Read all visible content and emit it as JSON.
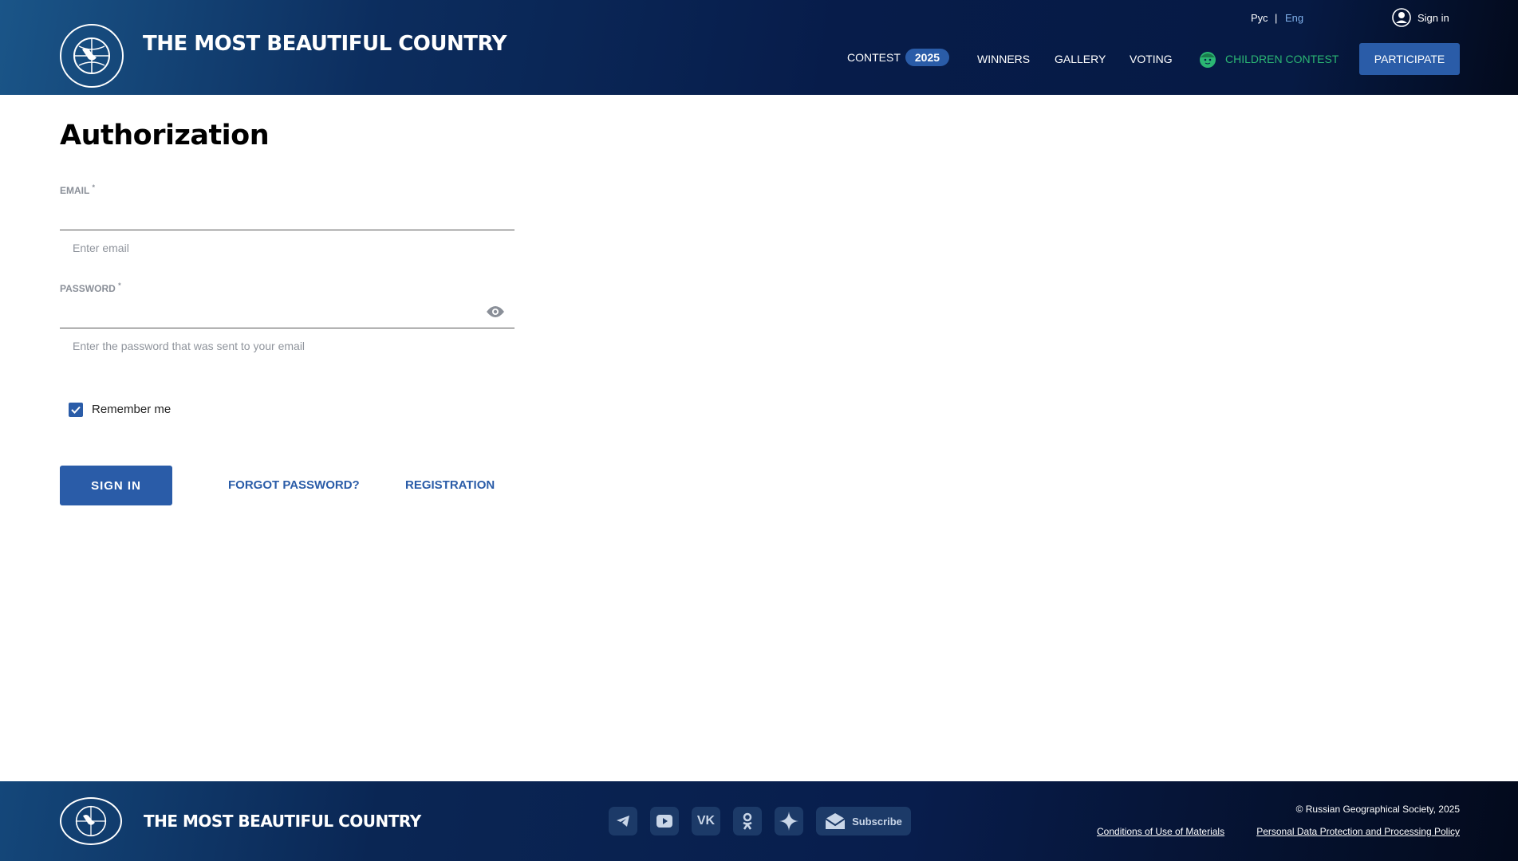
{
  "header": {
    "title": "THE MOST BEAUTIFUL COUNTRY",
    "lang_ru": "Рус",
    "lang_sep": "|",
    "lang_en": "Eng",
    "sign_in": "Sign in",
    "nav": {
      "contest": "CONTEST",
      "contest_year": "2025",
      "winners": "WINNERS",
      "gallery": "GALLERY",
      "voting": "VOTING",
      "children": "CHILDREN CONTEST",
      "participate": "PARTICIPATE"
    }
  },
  "form": {
    "title": "Authorization",
    "email_label": "EMAIL",
    "required": "*",
    "email_hint": "Enter email",
    "password_label": "PASSWORD",
    "password_hint": "Enter the password that was sent to your email",
    "remember": "Remember me",
    "remember_checked": true,
    "sign_in": "SIGN IN",
    "forgot": "FORGOT PASSWORD?",
    "registration": "REGISTRATION"
  },
  "footer": {
    "title": "THE MOST BEAUTIFUL COUNTRY",
    "subscribe": "Subscribe",
    "copyright": "© Russian Geographical Society, 2025",
    "conditions": "Conditions of Use of Materials",
    "privacy": "Personal Data Protection and Processing Policy",
    "social": [
      "telegram-icon",
      "youtube-icon",
      "vk-icon",
      "odnoklassniki-icon",
      "dzen-icon"
    ]
  },
  "colors": {
    "accent": "#2a5ca8",
    "children": "#2bb673",
    "header_bg": "#071c4a"
  }
}
